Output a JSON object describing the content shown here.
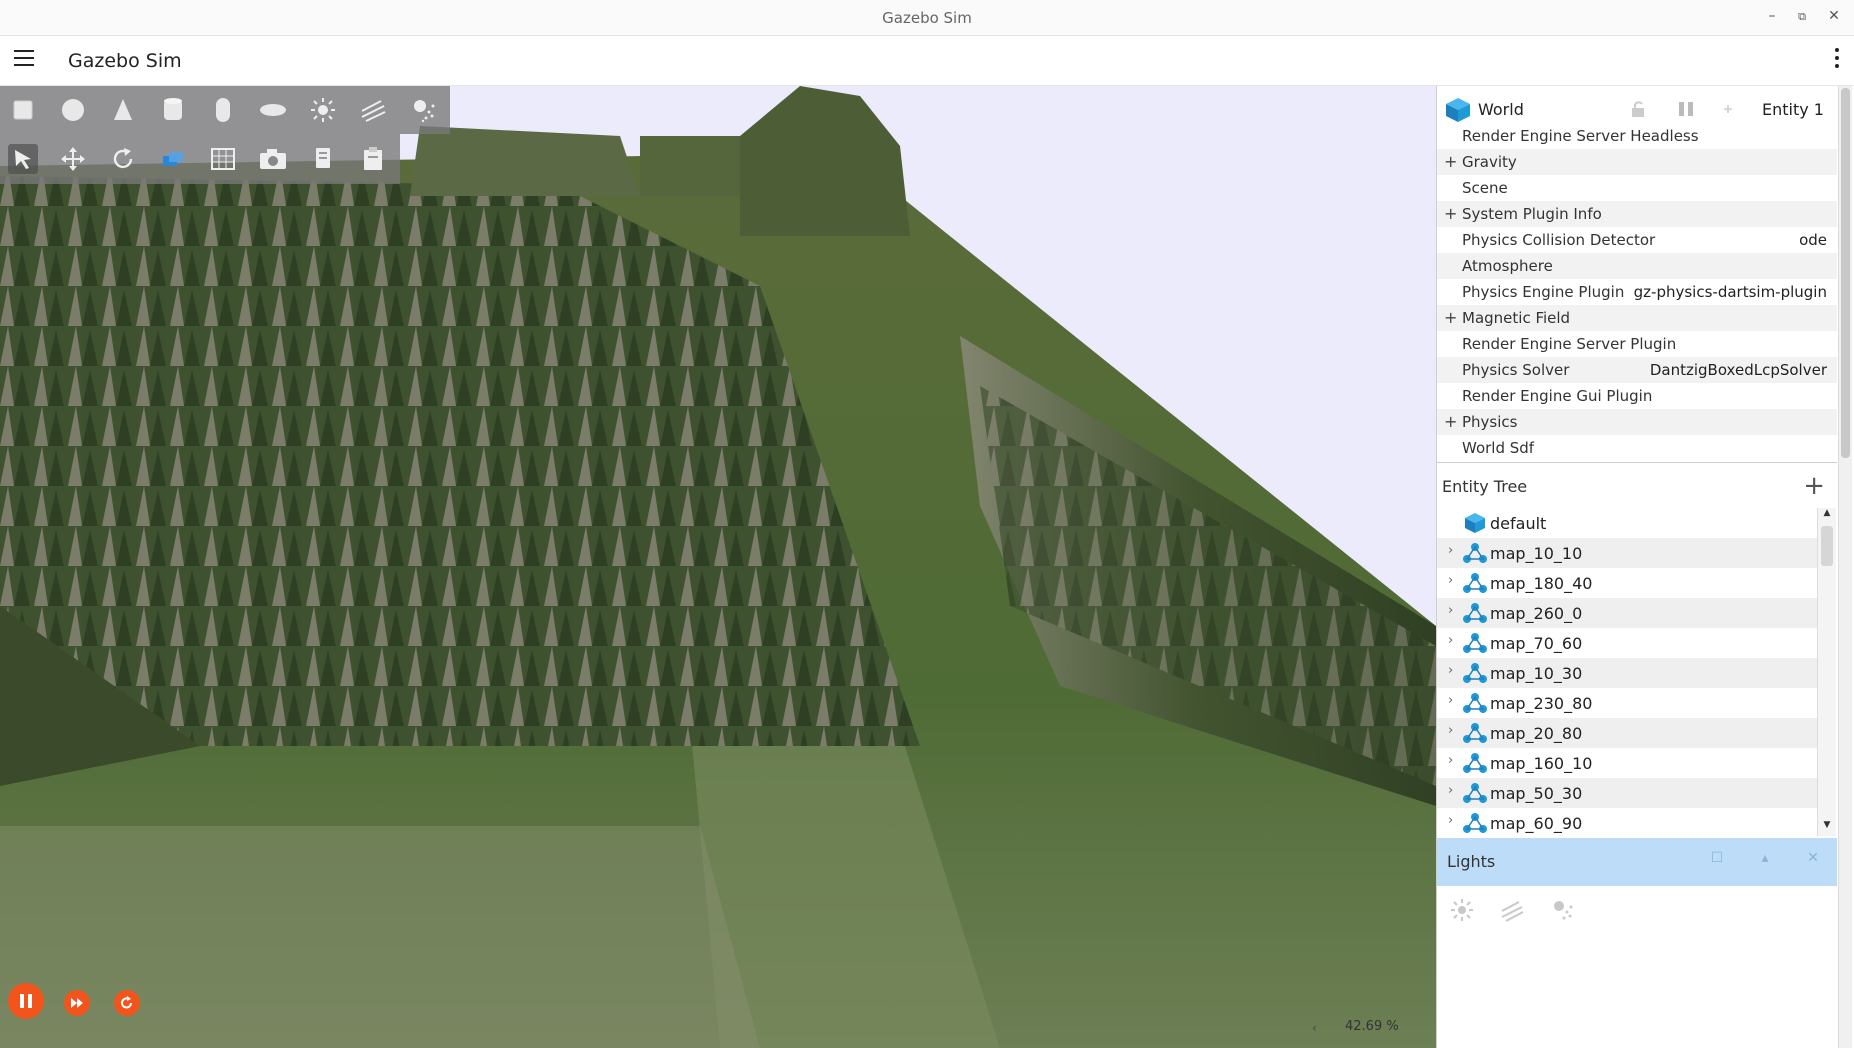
{
  "window": {
    "title": "Gazebo Sim",
    "minimize": "–",
    "restore": "⧉",
    "close": "✕"
  },
  "appbar": {
    "title": "Gazebo Sim"
  },
  "toolbars": {
    "shapes": [
      "box-icon",
      "sphere-icon",
      "cone-icon",
      "cylinder-icon",
      "capsule-icon",
      "ellipsoid-icon",
      "sun-icon",
      "directional-light-icon",
      "spot-light-icon"
    ],
    "transform": [
      "select-icon",
      "translate-icon",
      "rotate-icon",
      "view-angle-icon",
      "grid-icon",
      "camera-icon",
      "copy-icon",
      "paste-icon"
    ]
  },
  "scene": {
    "zoom": "42.69 %",
    "scroll_left_glyph": "‹"
  },
  "component_inspector": {
    "name": "World",
    "entity": "Entity 1",
    "rows": [
      {
        "label": "Render Engine Server Headless",
        "value": "",
        "expandable": false
      },
      {
        "label": "Gravity",
        "value": "",
        "expandable": true
      },
      {
        "label": "Scene",
        "value": "",
        "expandable": false
      },
      {
        "label": "System Plugin Info",
        "value": "",
        "expandable": true
      },
      {
        "label": "Physics Collision Detector",
        "value": "ode",
        "expandable": false
      },
      {
        "label": "Atmosphere",
        "value": "",
        "expandable": false
      },
      {
        "label": "Physics Engine Plugin",
        "value": "gz-physics-dartsim-plugin",
        "expandable": false
      },
      {
        "label": "Magnetic Field",
        "value": "",
        "expandable": true
      },
      {
        "label": "Render Engine Server Plugin",
        "value": "",
        "expandable": false
      },
      {
        "label": "Physics Solver",
        "value": "DantzigBoxedLcpSolver",
        "expandable": false
      },
      {
        "label": "Render Engine Gui Plugin",
        "value": "",
        "expandable": false
      },
      {
        "label": "Physics",
        "value": "",
        "expandable": true
      },
      {
        "label": "World Sdf",
        "value": "",
        "expandable": false
      }
    ]
  },
  "entity_tree": {
    "title": "Entity Tree",
    "add_label": "+",
    "items": [
      {
        "label": "default",
        "type": "world"
      },
      {
        "label": "map_10_10",
        "type": "model"
      },
      {
        "label": "map_180_40",
        "type": "model"
      },
      {
        "label": "map_260_0",
        "type": "model"
      },
      {
        "label": "map_70_60",
        "type": "model"
      },
      {
        "label": "map_10_30",
        "type": "model"
      },
      {
        "label": "map_230_80",
        "type": "model"
      },
      {
        "label": "map_20_80",
        "type": "model"
      },
      {
        "label": "map_160_10",
        "type": "model"
      },
      {
        "label": "map_50_30",
        "type": "model"
      },
      {
        "label": "map_60_90",
        "type": "model"
      }
    ]
  },
  "lights_panel": {
    "title": "Lights"
  },
  "colors": {
    "accent": "#f2541b",
    "lights_header": "#bcdcf7",
    "world_icon": "#1e9ad6"
  }
}
